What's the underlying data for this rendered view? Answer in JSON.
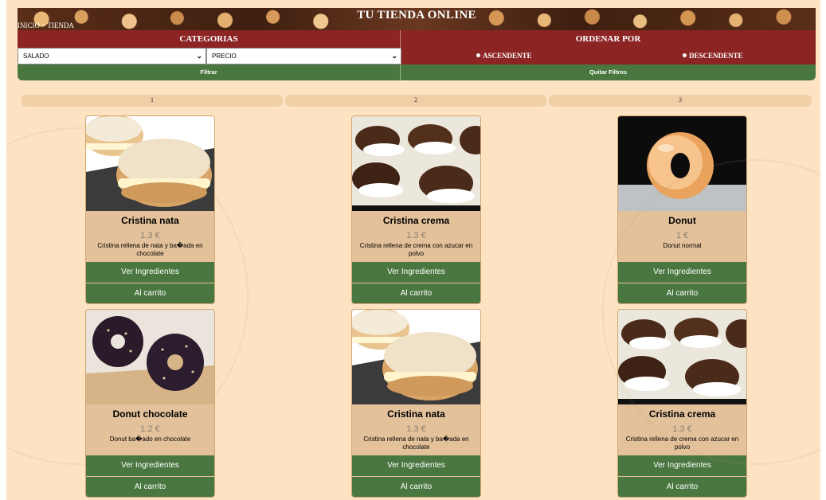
{
  "header": {
    "title": "TU TIENDA ONLINE",
    "breadcrumb": "INICIO > TIENDA"
  },
  "filters": {
    "categories_label": "CATEGORIAS",
    "order_label": "ORDENAR POR",
    "category_value": "SALADO",
    "sort_value": "PRECIO",
    "ascending_label": "ASCENDENTE",
    "descending_label": "DESCENDENTE",
    "filter_button": "Filtrar",
    "clear_button": "Quitar Filtros"
  },
  "pagination": [
    "1",
    "2",
    "3"
  ],
  "products": [
    {
      "name": "Cristina nata",
      "price": "1.3 €",
      "description": "Cristina rellena de nata y ba�ada en chocolate",
      "image": "cream-bun"
    },
    {
      "name": "Cristina crema",
      "price": "1.3 €",
      "description": "Cristina rellena de crema con azucar en polvo",
      "image": "chocolate-cream-buns"
    },
    {
      "name": "Donut",
      "price": "1 €",
      "description": "Donut normal",
      "image": "glazed-donut"
    },
    {
      "name": "Donut chocolate",
      "price": "1.2 €",
      "description": "Donut ba�ado en chocolate",
      "image": "chocolate-donuts"
    },
    {
      "name": "Cristina nata",
      "price": "1.3 €",
      "description": "Cristina rellena de nata y ba�ada en chocolate",
      "image": "cream-bun"
    },
    {
      "name": "Cristina crema",
      "price": "1.3 €",
      "description": "Cristina rellena de crema con azucar en polvo",
      "image": "chocolate-cream-buns"
    }
  ],
  "actions": {
    "ingredients": "Ver Ingredientes",
    "cart": "Al carrito"
  },
  "colors": {
    "background": "#fde3c2",
    "header_red": "#8c2424",
    "button_green": "#4a7640",
    "card": "#e3c19a"
  }
}
